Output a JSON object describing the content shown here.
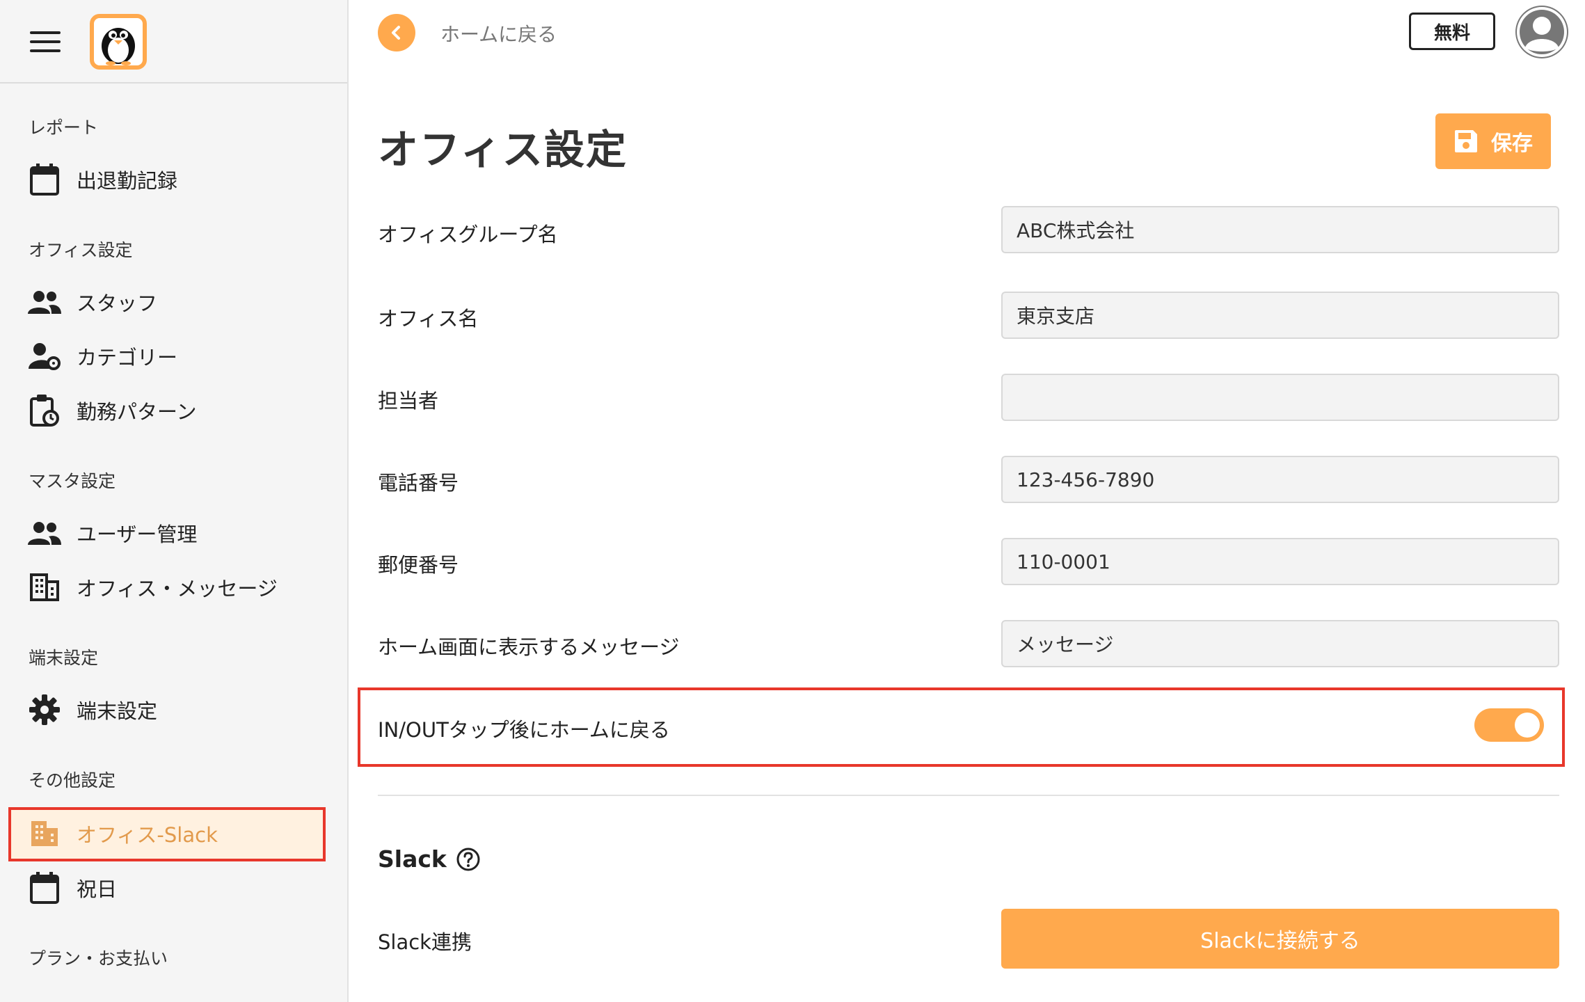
{
  "sidebar": {
    "sections": [
      {
        "title": "レポート",
        "items": [
          {
            "label": "出退勤記録",
            "icon": "calendar-icon"
          }
        ]
      },
      {
        "title": "オフィス設定",
        "items": [
          {
            "label": "スタッフ",
            "icon": "people-icon"
          },
          {
            "label": "カテゴリー",
            "icon": "person-gear-icon"
          },
          {
            "label": "勤務パターン",
            "icon": "clipboard-clock-icon"
          }
        ]
      },
      {
        "title": "マスタ設定",
        "items": [
          {
            "label": "ユーザー管理",
            "icon": "people-icon"
          },
          {
            "label": "オフィス・メッセージ",
            "icon": "building-icon"
          }
        ]
      },
      {
        "title": "端末設定",
        "items": [
          {
            "label": "端末設定",
            "icon": "gear-icon"
          }
        ]
      },
      {
        "title": "その他設定",
        "items": [
          {
            "label": "オフィス-Slack",
            "icon": "building-icon",
            "active": true
          },
          {
            "label": "祝日",
            "icon": "calendar-icon"
          }
        ]
      },
      {
        "title": "プラン・お支払い",
        "items": []
      }
    ]
  },
  "header": {
    "back_label": "ホームに戻る",
    "plan_badge": "無料"
  },
  "page": {
    "title": "オフィス設定",
    "save_label": "保存"
  },
  "form": {
    "office_group_label": "オフィスグループ名",
    "office_group_value": "ABC株式会社",
    "office_name_label": "オフィス名",
    "office_name_value": "東京支店",
    "contact_label": "担当者",
    "contact_value": "",
    "phone_label": "電話番号",
    "phone_value": "123-456-7890",
    "postal_label": "郵便番号",
    "postal_value": "110-0001",
    "home_message_label": "ホーム画面に表示するメッセージ",
    "home_message_value": "メッセージ",
    "return_home_label": "IN/OUTタップ後にホームに戻る",
    "return_home_enabled": true
  },
  "slack": {
    "heading": "Slack",
    "integration_label": "Slack連携",
    "connect_label": "Slackに接続する"
  },
  "colors": {
    "accent": "#ffa94d",
    "highlight": "#e8372b",
    "active_bg": "#fff1e0",
    "active_text": "#e29a4c"
  }
}
